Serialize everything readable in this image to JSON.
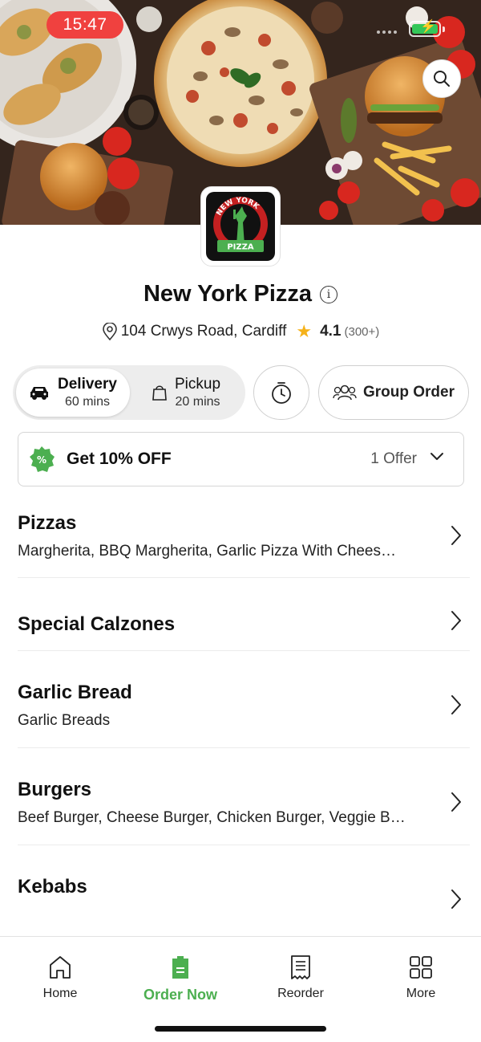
{
  "status_bar": {
    "time": "15:47"
  },
  "restaurant": {
    "logo_text_top": "NEW YORK",
    "logo_text_bottom": "PIZZA",
    "name": "New York Pizza",
    "address": "104 Crwys Road, Cardiff",
    "rating": "4.1",
    "rating_count": "(300+)"
  },
  "order_mode": {
    "delivery": {
      "label": "Delivery",
      "time": "60 mins",
      "selected": true
    },
    "pickup": {
      "label": "Pickup",
      "time": "20 mins",
      "selected": false
    }
  },
  "group_order_label": "Group Order",
  "offer": {
    "label": "Get 10% OFF",
    "count": "1 Offer",
    "badge_symbol": "%"
  },
  "categories": [
    {
      "name": "Pizzas",
      "desc": "Margherita, BBQ Margherita, Garlic Pizza With Chees…"
    },
    {
      "name": "Special Calzones",
      "desc": ""
    },
    {
      "name": "Garlic Bread",
      "desc": "Garlic Breads"
    },
    {
      "name": "Burgers",
      "desc": "Beef Burger, Cheese Burger, Chicken Burger, Veggie B…"
    },
    {
      "name": "Kebabs",
      "desc": ""
    }
  ],
  "bottom_nav": [
    {
      "label": "Home",
      "icon": "home-icon",
      "active": false
    },
    {
      "label": "Order Now",
      "icon": "order-icon",
      "active": true
    },
    {
      "label": "Reorder",
      "icon": "receipt-icon",
      "active": false
    },
    {
      "label": "More",
      "icon": "grid-icon",
      "active": false
    }
  ],
  "colors": {
    "accent": "#4caf50",
    "status_time_bg": "#f0413f",
    "star": "#f5b21a"
  }
}
